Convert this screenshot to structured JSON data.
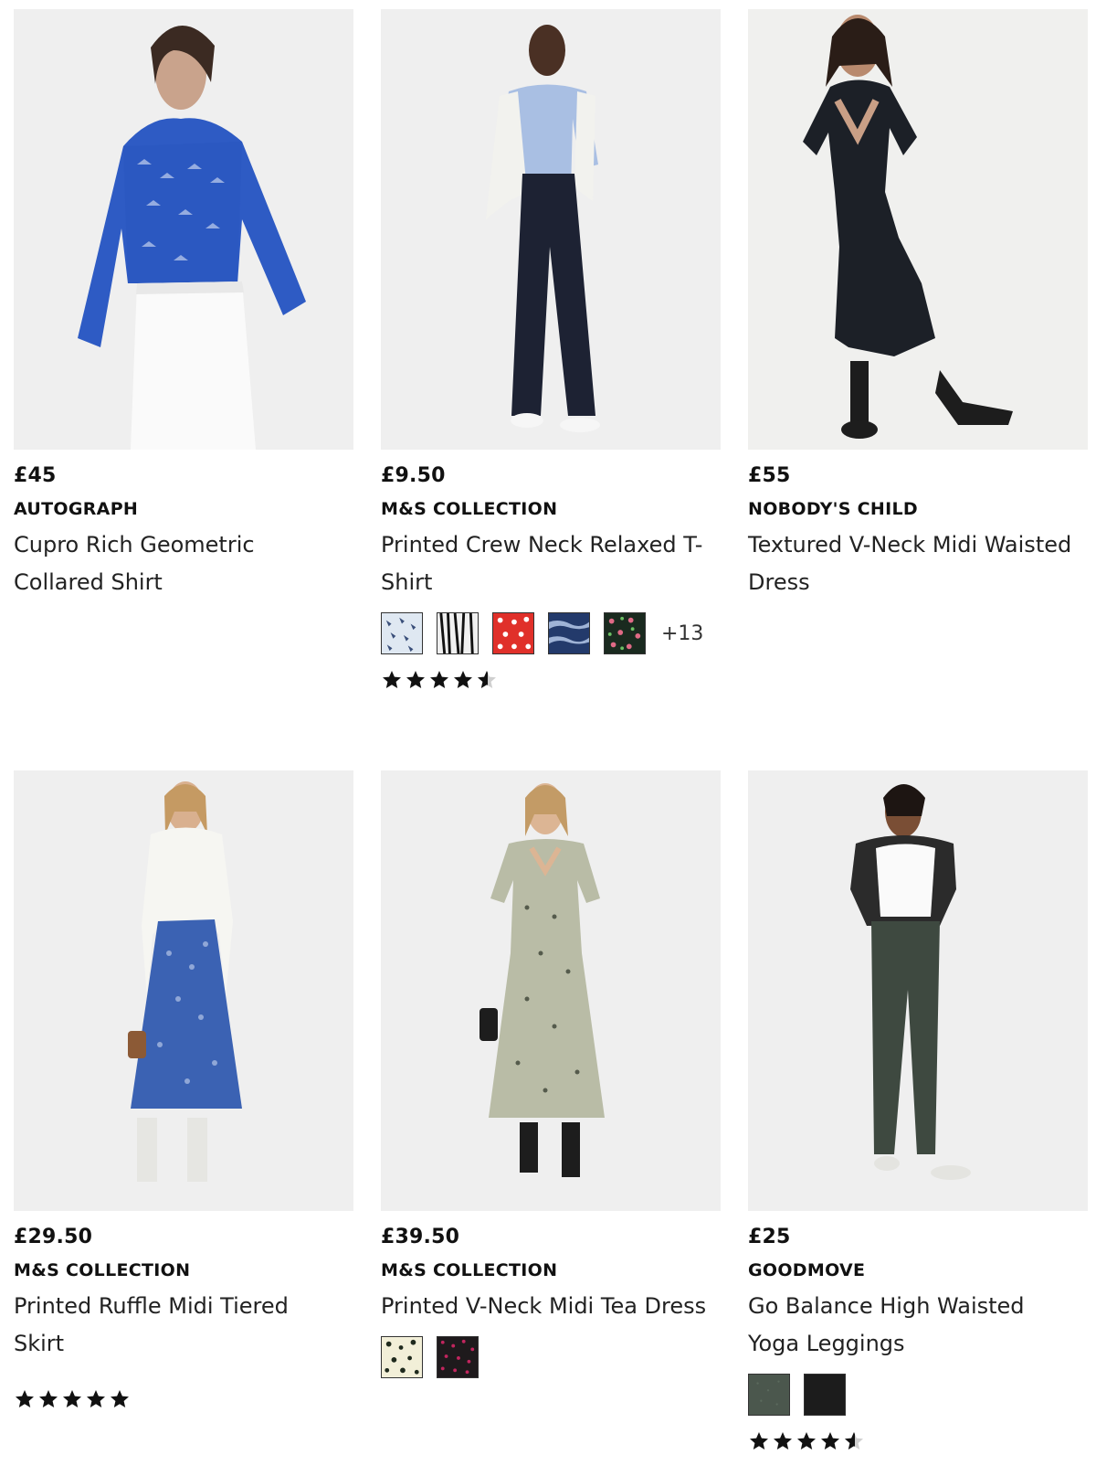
{
  "products": [
    {
      "price": "£45",
      "brand": "AUTOGRAPH",
      "title": "Cupro Rich Geometric Collared Shirt",
      "image_alt": "Model wearing blue geometric print collared shirt with white skirt"
    },
    {
      "price": "£9.50",
      "brand": "M&S COLLECTION",
      "title": "Printed Crew Neck Relaxed T-Shirt",
      "image_alt": "Model wearing blue printed t-shirt and dark wide-leg jeans",
      "swatches": [
        "light-blue-print",
        "black-white-print",
        "red-polka-dot",
        "blue-tie-dye",
        "dark-floral"
      ],
      "more_colours": "+13",
      "rating": 4.5
    },
    {
      "price": "£55",
      "brand": "NOBODY'S CHILD",
      "title": "Textured V-Neck Midi Waisted Dress",
      "image_alt": "Model wearing black v-neck midi dress with boots"
    },
    {
      "price": "£29.50",
      "brand": "M&S COLLECTION",
      "title": "Printed Ruffle Midi Tiered Skirt",
      "image_alt": "Model wearing blue printed tiered skirt with white top",
      "rating": 5
    },
    {
      "price": "£39.50",
      "brand": "M&S COLLECTION",
      "title": "Printed V-Neck Midi Tea Dress",
      "image_alt": "Model wearing printed v-neck midi tea dress",
      "swatches": [
        "cream-floral",
        "pink-black-print"
      ]
    },
    {
      "price": "£25",
      "brand": "GOODMOVE",
      "title": "Go Balance High Waisted Yoga Leggings",
      "image_alt": "Model wearing khaki high waisted yoga leggings",
      "swatches": [
        "khaki",
        "black"
      ],
      "rating": 4.5
    }
  ]
}
